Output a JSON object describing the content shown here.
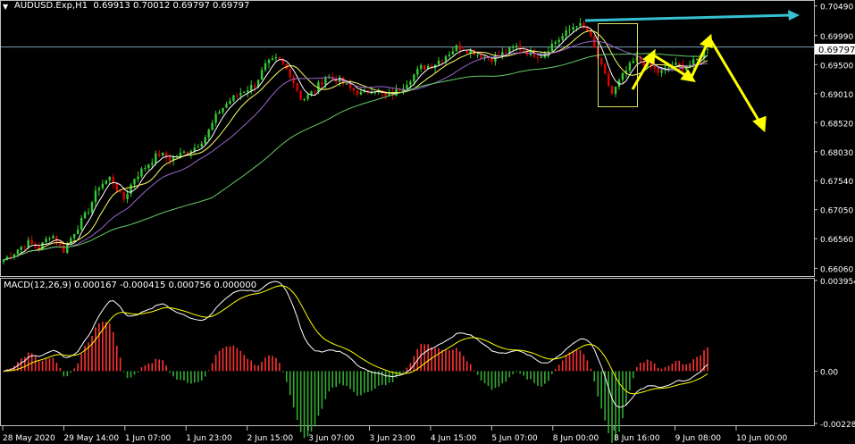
{
  "header": {
    "symbol": "AUDUSD.Exp,H1",
    "ohlc": "0.69913 0.70012 0.69797 0.69797"
  },
  "current_price_label": "0.69797",
  "macd": {
    "label": "MACD(12,26,9) 0.000167 -0.000415 0.000756 0.000000"
  },
  "colors": {
    "background": "#000000",
    "bull_candle": "#32cd32",
    "bear_candle": "#e00000",
    "ma_fast": "#ffffff",
    "ma_mid": "#ffff66",
    "ma_slow_purple": "#9966cc",
    "ma_long": "#66cc66",
    "price_line": "#7a9fb8",
    "cyan_arrow": "#36c0d0",
    "yellow_arrow": "#ffff00",
    "macd_line": "#ffffff",
    "signal_line": "#ffff00",
    "hist_pos": "#ff3333",
    "hist_neg": "#33aa33"
  },
  "chart_data": {
    "type": "candlestick",
    "price_axis_ticks": [
      "0.70490",
      "0.69990",
      "0.69500",
      "0.69010",
      "0.68520",
      "0.68030",
      "0.67540",
      "0.67050",
      "0.66560",
      "0.66060"
    ],
    "macd_axis_ticks": [
      "0.003954",
      "0.00",
      "-0.002283"
    ],
    "time_axis_labels": [
      "28 May 2020",
      "29 May 14:00",
      "1 Jun 07:00",
      "1 Jun 23:00",
      "2 Jun 15:00",
      "3 Jun 07:00",
      "3 Jun 23:00",
      "4 Jun 15:00",
      "5 Jun 07:00",
      "8 Jun 00:00",
      "8 Jun 16:00",
      "9 Jun 08:00",
      "10 Jun 00:00"
    ],
    "price_ylim": [
      0.6596,
      0.7056
    ],
    "last_price": 0.69797,
    "close_path": [
      0.662,
      0.6635,
      0.665,
      0.664,
      0.6665,
      0.6635,
      0.667,
      0.67,
      0.6745,
      0.676,
      0.672,
      0.676,
      0.678,
      0.68,
      0.679,
      0.68,
      0.681,
      0.683,
      0.687,
      0.689,
      0.6905,
      0.6915,
      0.695,
      0.696,
      0.6935,
      0.689,
      0.6905,
      0.693,
      0.6925,
      0.691,
      0.69,
      0.691,
      0.6895,
      0.6905,
      0.6925,
      0.6945,
      0.695,
      0.6965,
      0.698,
      0.6975,
      0.6965,
      0.696,
      0.697,
      0.698,
      0.697,
      0.6965,
      0.6985,
      0.7,
      0.702,
      0.7005,
      0.695,
      0.69,
      0.6935,
      0.696,
      0.695,
      0.6935,
      0.695,
      0.6945,
      0.6955,
      0.698
    ],
    "macd_ylim": [
      -0.002283,
      0.003954
    ]
  }
}
